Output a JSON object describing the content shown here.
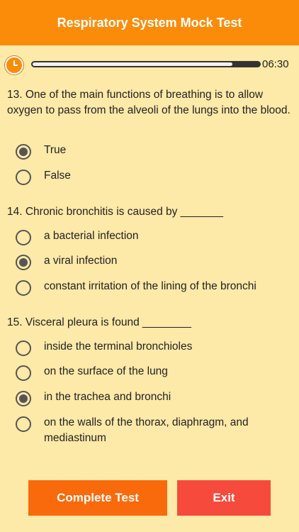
{
  "header": {
    "title": "Respiratory System Mock Test"
  },
  "timer": {
    "icon": "clock-icon",
    "remaining": "06:30",
    "progress_fraction": 0.88
  },
  "questions": [
    {
      "text": "13. One of the main functions of breathing is to allow oxygen to pass from the alveoli of the lungs  into the blood.",
      "options": [
        {
          "label": "True",
          "selected": true
        },
        {
          "label": "False",
          "selected": false
        }
      ]
    },
    {
      "text": "14. Chronic bronchitis is caused by _______",
      "options": [
        {
          "label": "a bacterial infection",
          "selected": false
        },
        {
          "label": "a viral infection",
          "selected": true
        },
        {
          "label": "constant irritation of the lining of the bronchi",
          "selected": false
        }
      ]
    },
    {
      "text": "15. Visceral pleura is found ________",
      "options": [
        {
          "label": "inside the terminal bronchioles",
          "selected": false
        },
        {
          "label": "on the surface of the lung",
          "selected": false
        },
        {
          "label": "in the trachea and bronchi",
          "selected": true
        },
        {
          "label": "on the walls of the thorax, diaphragm, and mediastinum",
          "selected": false
        }
      ]
    }
  ],
  "buttons": {
    "complete_label": "Complete Test",
    "exit_label": "Exit"
  },
  "colors": {
    "header": "#fb8c0a",
    "background": "#fde9a8",
    "complete_button": "#f96a0c",
    "exit_button": "#f64a3d"
  }
}
